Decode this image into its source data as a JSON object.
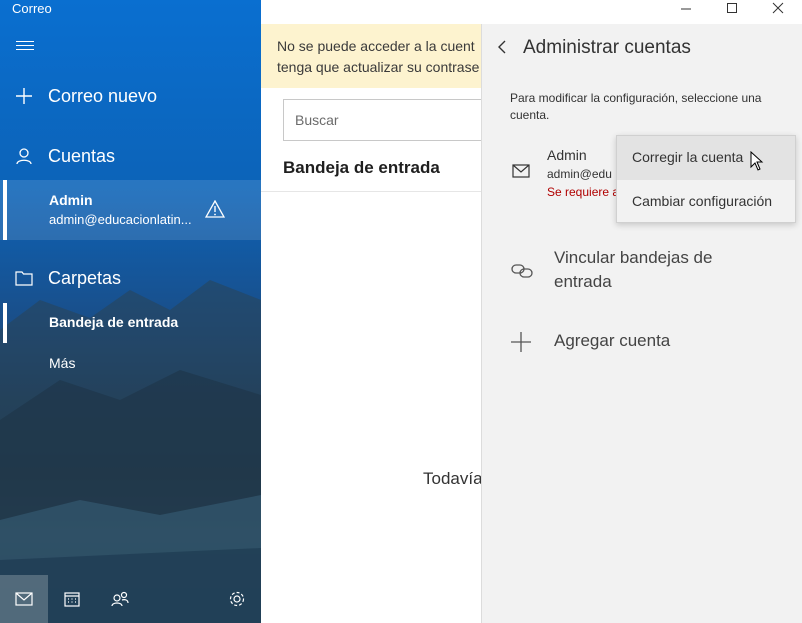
{
  "app": {
    "title": "Correo",
    "accent": "#0c63b8"
  },
  "nav": {
    "menu_icon": "hamburger-icon",
    "new_mail": "Correo nuevo",
    "accounts_header": "Cuentas",
    "account": {
      "name": "Admin",
      "email": "admin@educacionlatin..."
    },
    "folders_header": "Carpetas",
    "inbox": "Bandeja de entrada",
    "more": "Más"
  },
  "middle": {
    "notice_line1": "No se puede acceder a la cuent",
    "notice_line2": "tenga que actualizar su contrase",
    "search_placeholder": "Buscar",
    "folder_title": "Bandeja de entrada",
    "empty_text": "Todavía"
  },
  "flyout": {
    "title": "Administrar cuentas",
    "description": "Para modificar la configuración, seleccione una cuenta.",
    "account_name": "Admin",
    "account_email": "admin@edu",
    "account_error": "Se requiere a",
    "link_inboxes": "Vincular bandejas de entrada",
    "add_account": "Agregar cuenta",
    "error_color": "#b00000"
  },
  "context_menu": {
    "fix_account": "Corregir la cuenta",
    "change_settings": "Cambiar configuración"
  }
}
